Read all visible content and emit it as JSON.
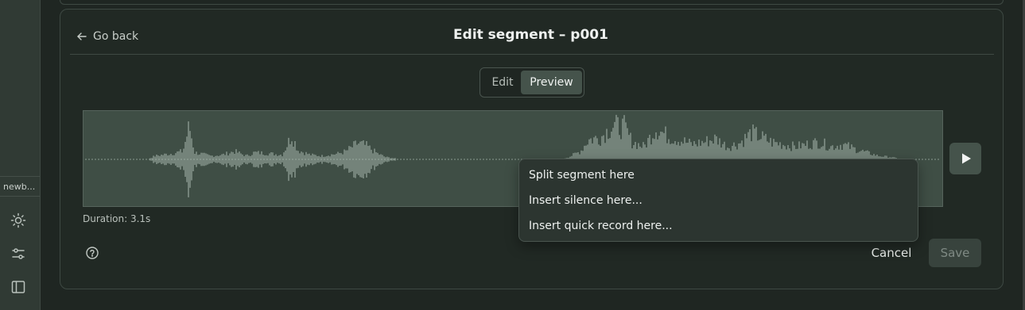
{
  "sidebar": {
    "project_label": "newb...",
    "icons": [
      "sun-icon",
      "sliders-icon",
      "sidebar-toggle-icon"
    ]
  },
  "header": {
    "back_label": "Go back",
    "title": "Edit segment – p001"
  },
  "mode_toggle": {
    "options": [
      "Edit",
      "Preview"
    ],
    "selected": "Preview"
  },
  "waveform": {
    "duration_text": "Duration: 3.1s",
    "play_icon": "play-icon"
  },
  "context_menu": {
    "items": [
      "Split segment here",
      "Insert silence here...",
      "Insert quick record here..."
    ]
  },
  "footer": {
    "help_icon": "help-icon",
    "cancel_label": "Cancel",
    "save_label": "Save"
  },
  "colors": {
    "background": "#1d2320",
    "panel": "#212924",
    "waveform_bg": "#3f4e45",
    "accent_button": "#45534b"
  }
}
